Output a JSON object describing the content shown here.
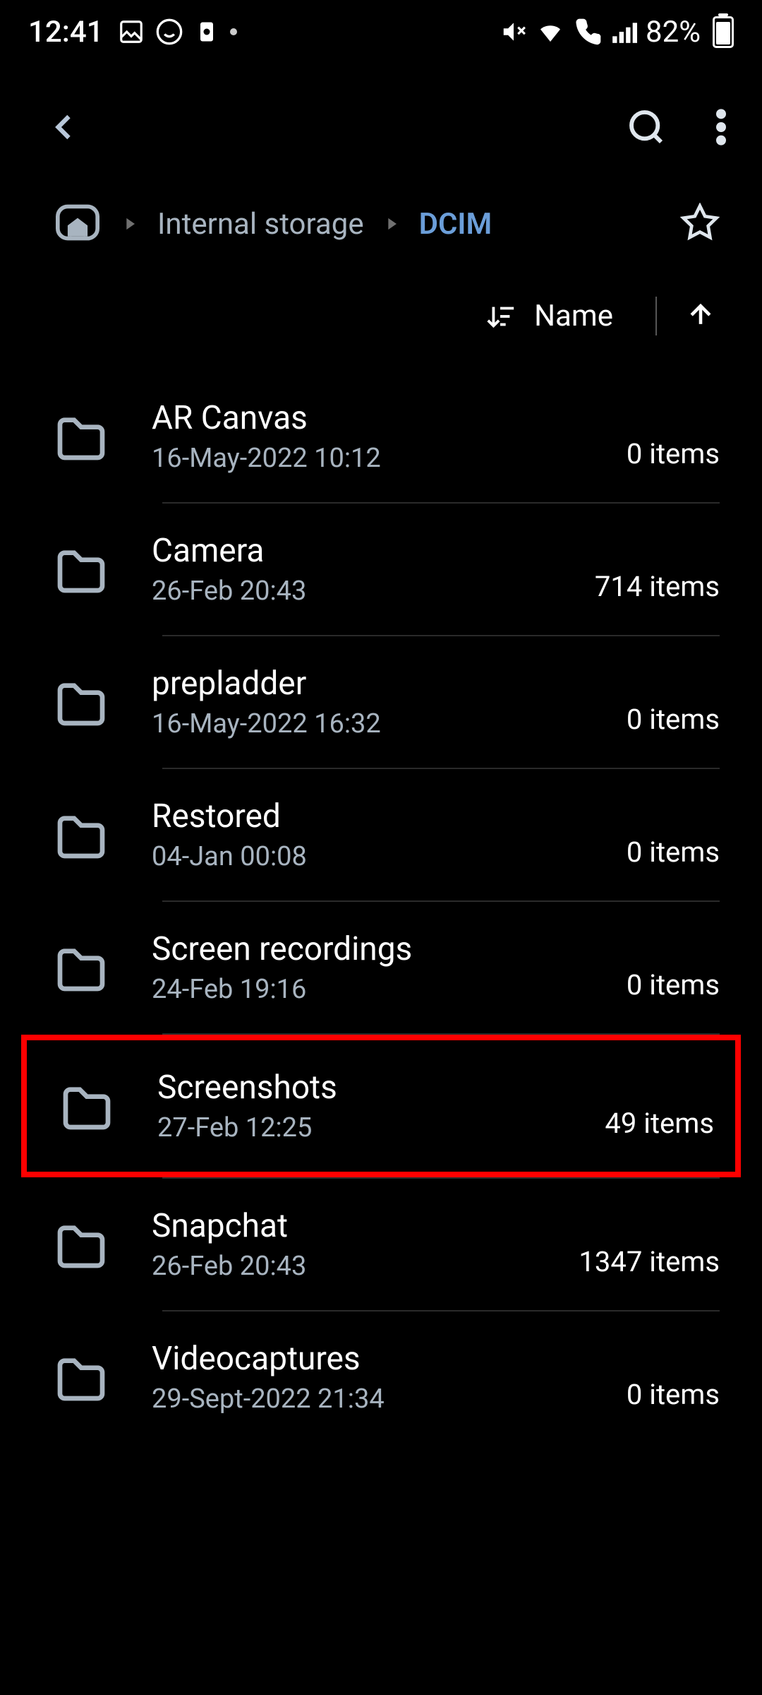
{
  "status": {
    "time": "12:41",
    "battery": "82%"
  },
  "breadcrumb": {
    "parent": "Internal storage",
    "current": "DCIM"
  },
  "sort": {
    "label": "Name"
  },
  "folders": [
    {
      "name": "AR Canvas",
      "date": "16-May-2022 10:12",
      "count": "0 items",
      "highlighted": false
    },
    {
      "name": "Camera",
      "date": "26-Feb 20:43",
      "count": "714 items",
      "highlighted": false
    },
    {
      "name": "prepladder",
      "date": "16-May-2022 16:32",
      "count": "0 items",
      "highlighted": false
    },
    {
      "name": "Restored",
      "date": "04-Jan 00:08",
      "count": "0 items",
      "highlighted": false
    },
    {
      "name": "Screen recordings",
      "date": "24-Feb 19:16",
      "count": "0 items",
      "highlighted": false
    },
    {
      "name": "Screenshots",
      "date": "27-Feb 12:25",
      "count": "49 items",
      "highlighted": true
    },
    {
      "name": "Snapchat",
      "date": "26-Feb 20:43",
      "count": "1347 items",
      "highlighted": false
    },
    {
      "name": "Videocaptures",
      "date": "29-Sept-2022 21:34",
      "count": "0 items",
      "highlighted": false
    }
  ]
}
